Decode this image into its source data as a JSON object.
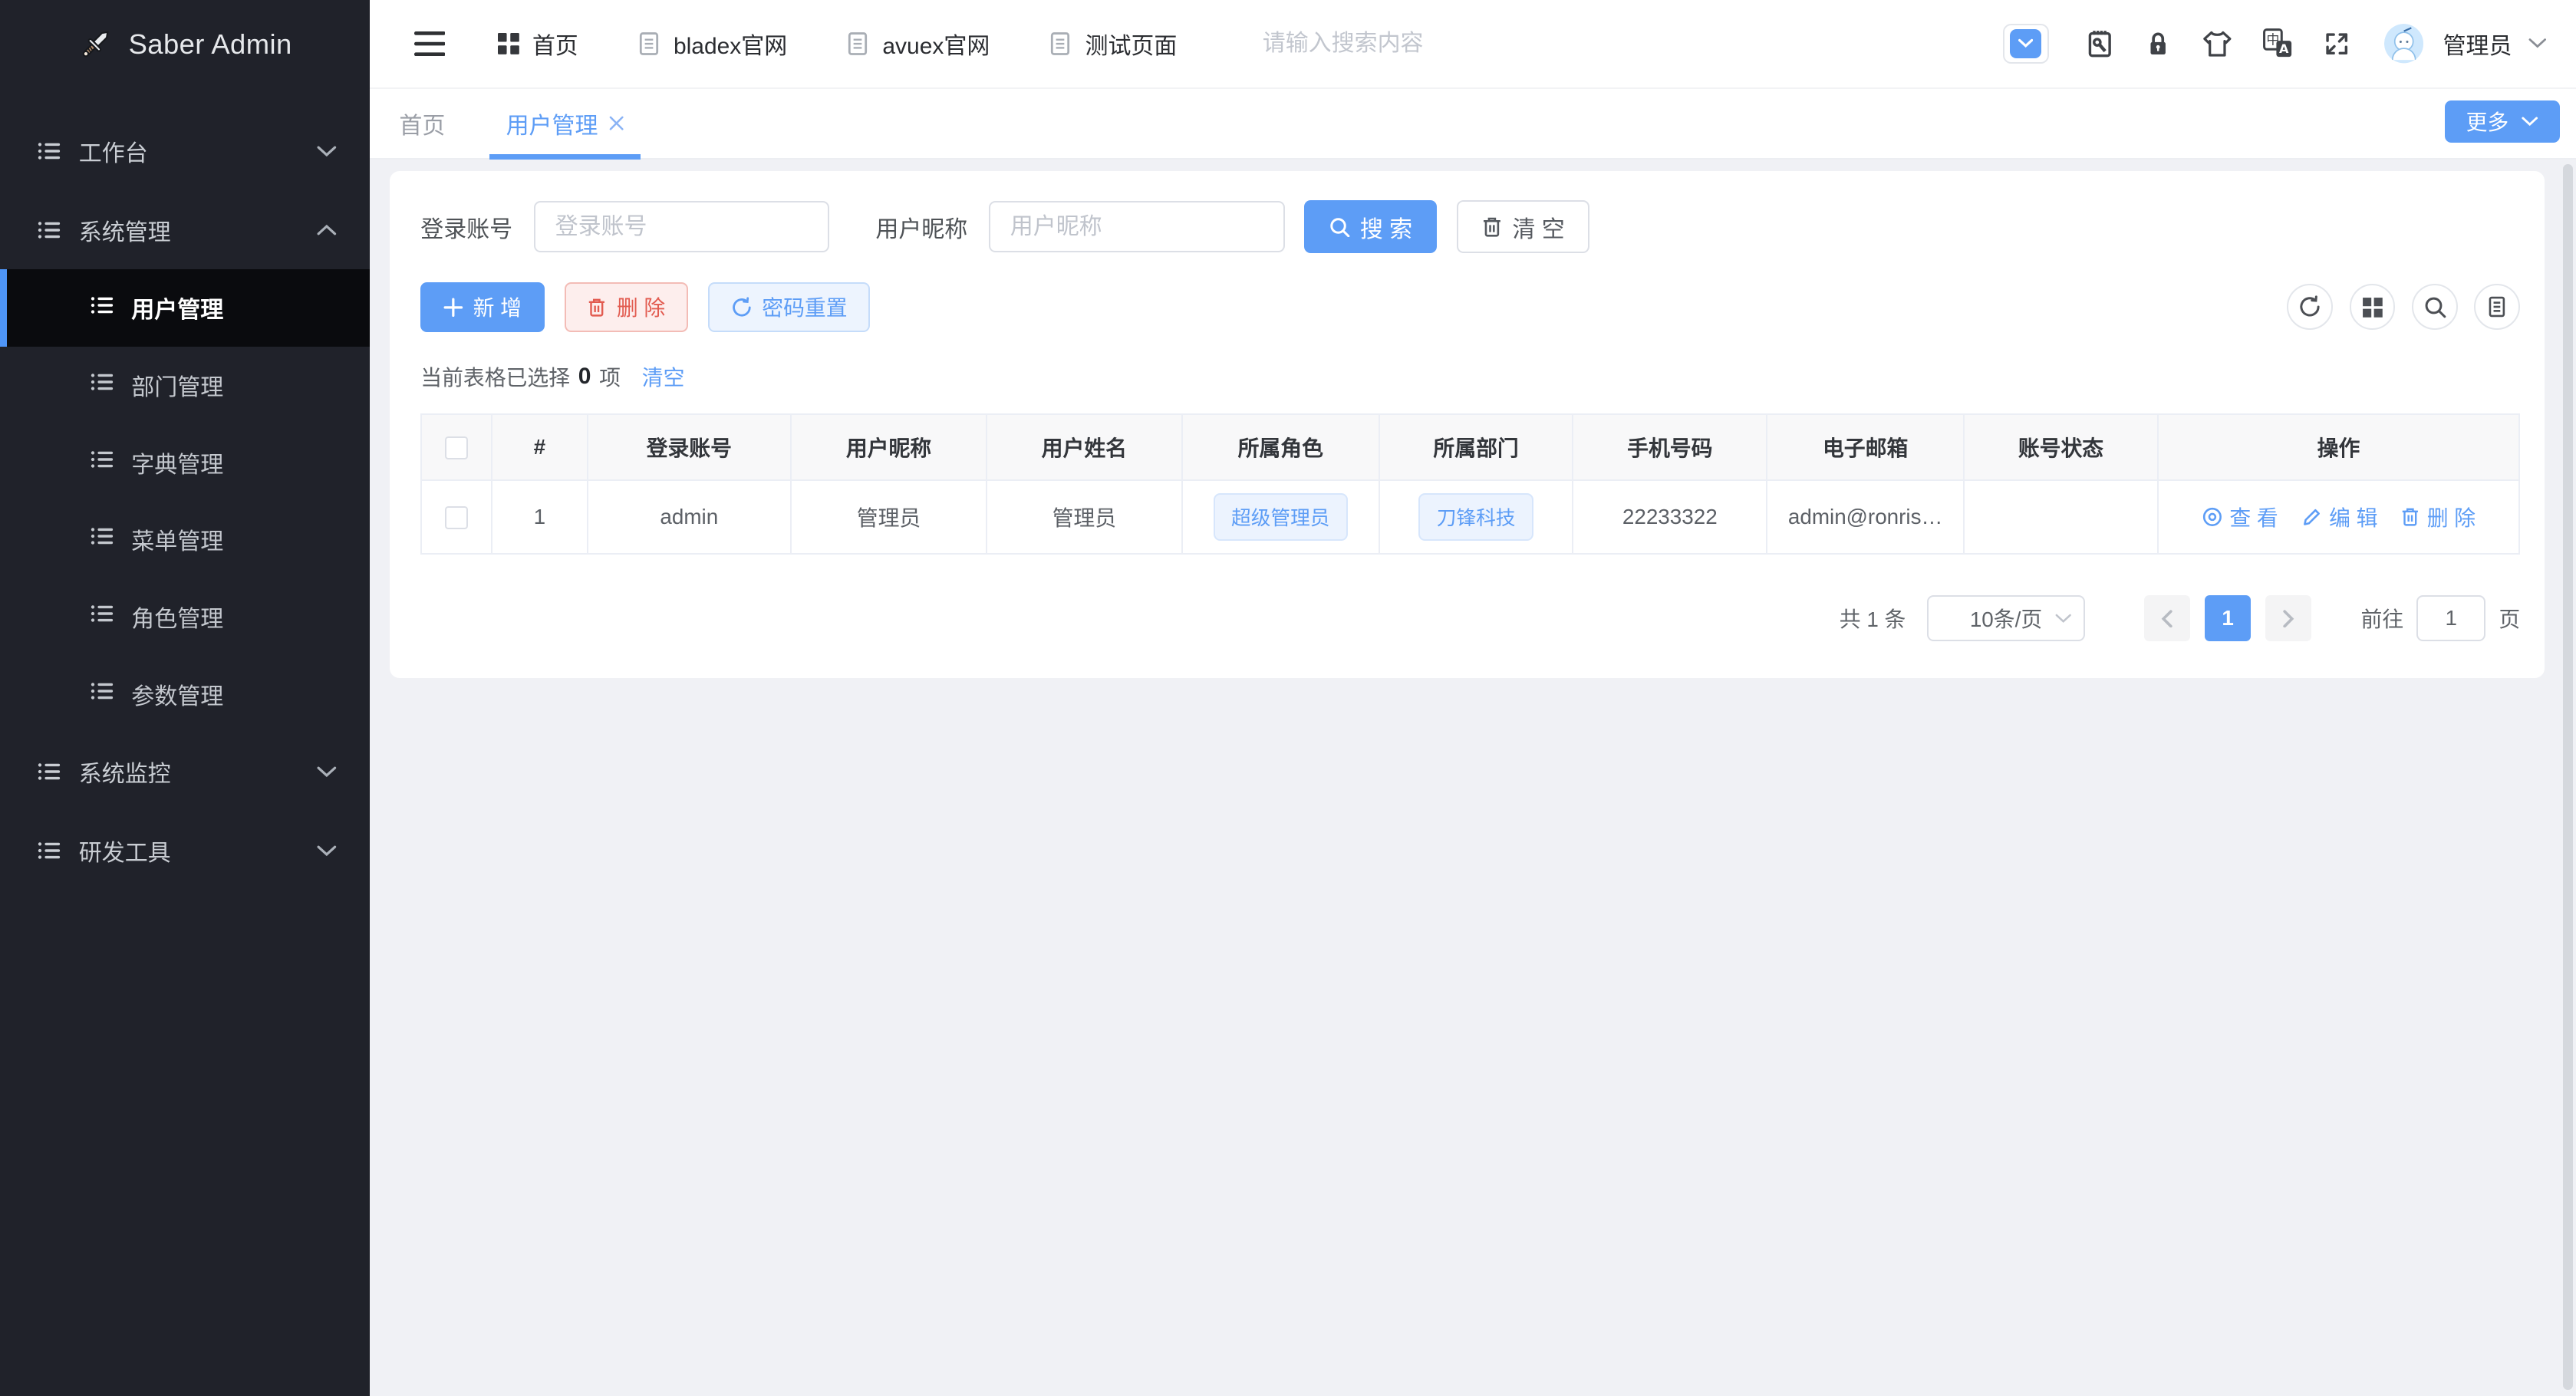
{
  "app": {
    "logo_text": "Saber Admin"
  },
  "colors": {
    "accent": "#5d9df6",
    "danger_text": "#e25b50",
    "sidebar_bg": "#20222a",
    "sidebar_active_bg": "#0a0b0e",
    "content_bg": "#f0f1f5",
    "tag_bg": "#ecf3fe"
  },
  "icons": {
    "logo": "dagger-icon",
    "menu_entry": "list-icon",
    "nav_home": "grid-icon",
    "nav_page": "document-icon",
    "top_right": [
      "collapse-toggle-icon",
      "debug-clipboard-icon",
      "lock-icon",
      "theme-shirt-icon",
      "translate-icon",
      "fullscreen-icon"
    ],
    "crud_toolbar": [
      "refresh-icon",
      "grid-icon",
      "search-icon",
      "document-lines-icon"
    ]
  },
  "sidebar": {
    "items": [
      {
        "label": "工作台",
        "state": "collapsed"
      },
      {
        "label": "系统管理",
        "state": "expanded"
      },
      {
        "label": "系统监控",
        "state": "collapsed"
      },
      {
        "label": "研发工具",
        "state": "collapsed"
      }
    ],
    "submenu": [
      {
        "label": "用户管理",
        "active": true
      },
      {
        "label": "部门管理"
      },
      {
        "label": "字典管理"
      },
      {
        "label": "菜单管理"
      },
      {
        "label": "角色管理"
      },
      {
        "label": "参数管理"
      }
    ]
  },
  "topbar": {
    "nav": [
      {
        "label": "首页"
      },
      {
        "label": "bladex官网"
      },
      {
        "label": "avuex官网"
      },
      {
        "label": "测试页面"
      }
    ],
    "search_placeholder": "请输入搜索内容",
    "user_name": "管理员"
  },
  "tabs": {
    "items": [
      {
        "label": "首页"
      },
      {
        "label": "用户管理",
        "active": true,
        "closable": true
      }
    ],
    "more_label": "更多"
  },
  "filters": {
    "account_label": "登录账号",
    "account_placeholder": "登录账号",
    "account_value": "",
    "nickname_label": "用户昵称",
    "nickname_placeholder": "用户昵称",
    "nickname_value": "",
    "search_label": "搜 索",
    "clear_label": "清 空"
  },
  "toolbar": {
    "add_label": "新 增",
    "delete_label": "删 除",
    "reset_label": "密码重置"
  },
  "selection": {
    "prefix": "当前表格已选择",
    "count": "0",
    "suffix": "项",
    "clear_label": "清空"
  },
  "table": {
    "headers": [
      "#",
      "登录账号",
      "用户昵称",
      "用户姓名",
      "所属角色",
      "所属部门",
      "手机号码",
      "电子邮箱",
      "账号状态",
      "操作"
    ],
    "rows": [
      {
        "index": "1",
        "account": "admin",
        "nickname": "管理员",
        "name": "管理员",
        "role_tag": "超级管理员",
        "dept_tag": "刀锋科技",
        "phone": "22233322",
        "email": "admin@ronris…",
        "status": "",
        "actions": {
          "view": "查 看",
          "edit": "编 辑",
          "delete": "删 除"
        }
      }
    ]
  },
  "pagination": {
    "total": "共 1 条",
    "page_size": "10条/页",
    "current_page": "1",
    "goto_label": "前往",
    "goto_value": "1",
    "page_label": "页"
  }
}
